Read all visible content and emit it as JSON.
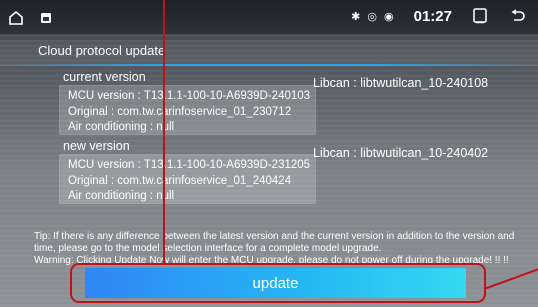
{
  "statusbar": {
    "indicators": "✱ ◎ ◉",
    "time": "01:27"
  },
  "page": {
    "title": "Cloud protocol update"
  },
  "current": {
    "label": "current version",
    "mcu": "MCU version : T13.1.1-100-10-A6939D-240103",
    "original": "Original : com.tw.carinfoservice_01_230712",
    "aircon": "Air conditioning : null",
    "libcan": "Libcan : libtwutilcan_10-240108"
  },
  "new": {
    "label": "new version",
    "mcu": "MCU version : T13.1.1-100-10-A6939D-231205",
    "original": "Original : com.tw.carinfoservice_01_240424",
    "aircon": "Air conditioning : null",
    "libcan": "Libcan : libtwutilcan_10-240402"
  },
  "tip": {
    "line1": "Tip: If there is any difference between the latest version and the current version in addition to the version and",
    "line2": "time, please go to the model selection interface for a complete model upgrade.",
    "line3": "Warning: Clicking Update Now will enter the MCU upgrade, please do not power off during the upgrade! !! !!"
  },
  "actions": {
    "update_label": "update"
  },
  "colors": {
    "accent_start": "#2f86f5",
    "accent_end": "#34d8f0",
    "annotation": "#c0121b"
  }
}
